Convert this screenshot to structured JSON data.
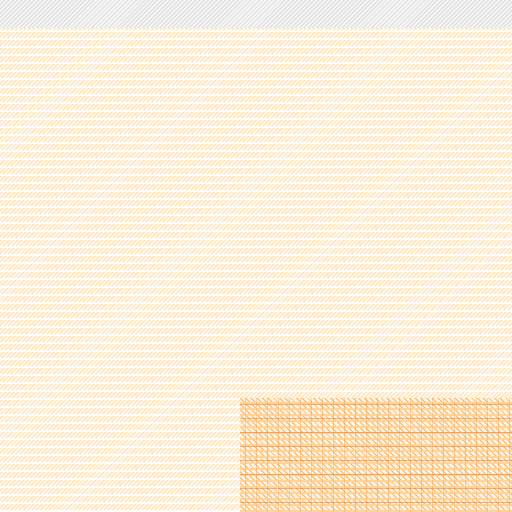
{
  "colors": {
    "background": "#fff7ea",
    "hatch": "#ffdfb0",
    "top_strip": "#f6f6f6",
    "glitch_accent": "#f5b66a"
  }
}
